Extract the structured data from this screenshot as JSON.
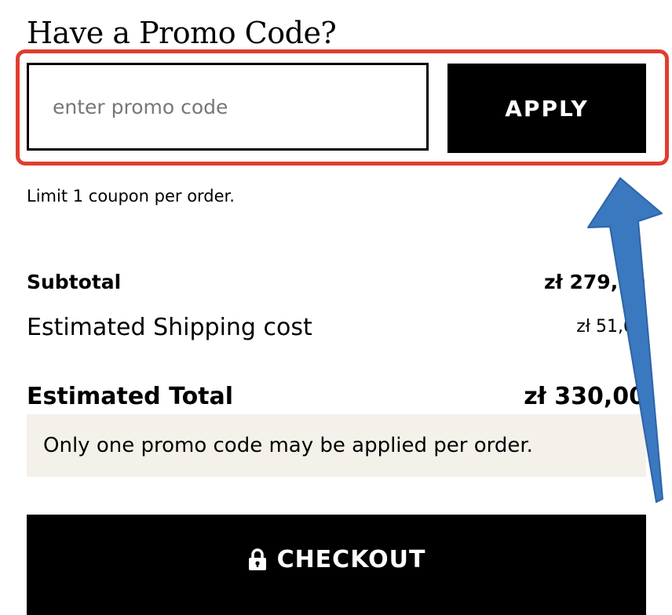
{
  "promo": {
    "heading": "Have a Promo Code?",
    "input_placeholder": "enter promo code",
    "input_value": "",
    "apply_label": "APPLY",
    "limit_text": "Limit 1 coupon per order."
  },
  "summary": {
    "subtotal_label": "Subtotal",
    "subtotal_value": "zł 279,00",
    "shipping_label": "Estimated Shipping cost",
    "shipping_value": "zł 51,00",
    "total_label": "Estimated Total",
    "total_value": "zł 330,00"
  },
  "notice": {
    "text": "Only one promo code may be applied per order."
  },
  "checkout": {
    "label": "CHECKOUT",
    "icon": "lock-icon"
  },
  "colors": {
    "highlight_border": "#e03d2f",
    "annotation_arrow": "#3a78c0",
    "notice_background": "#f4f0ea",
    "button_background": "#000000"
  }
}
